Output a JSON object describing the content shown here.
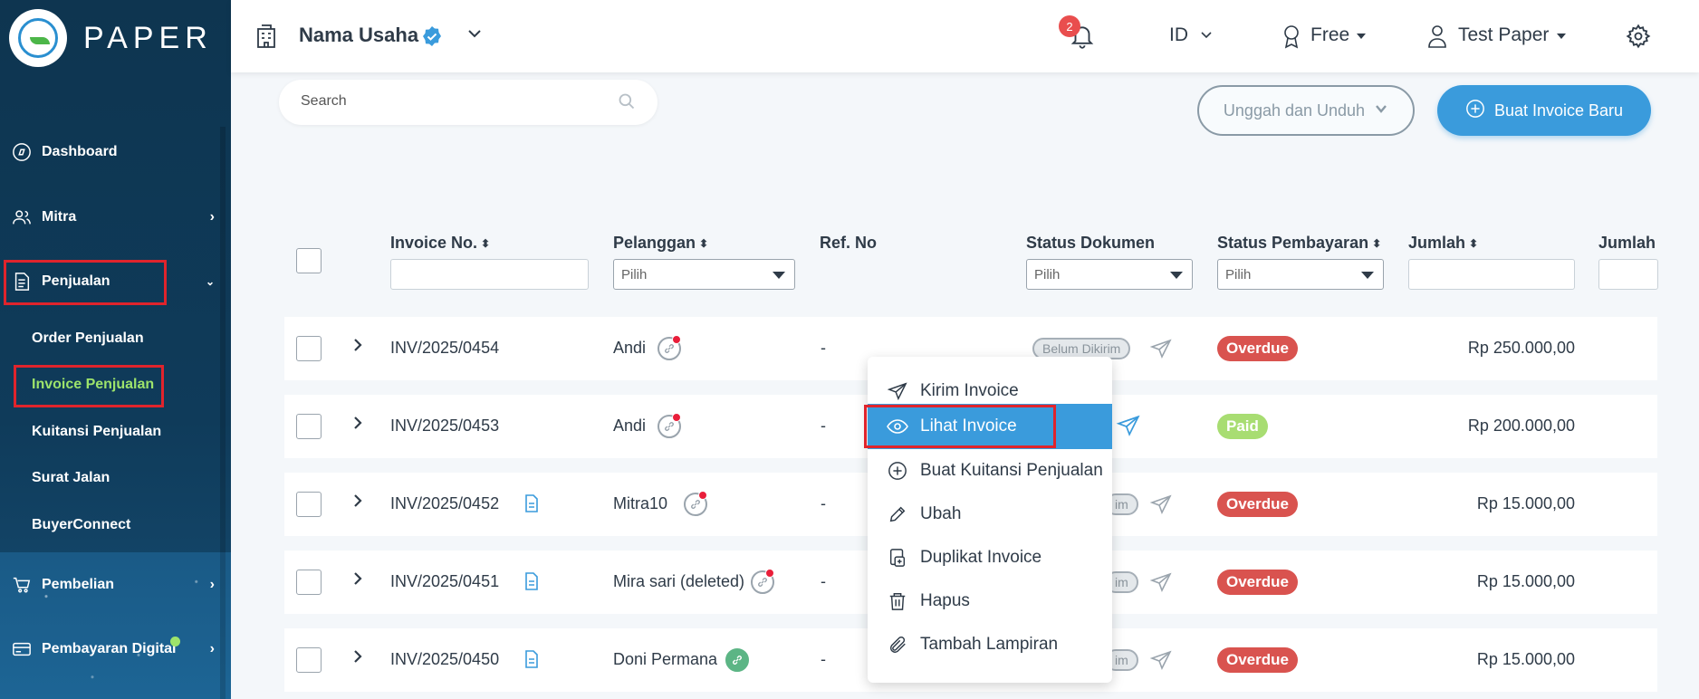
{
  "brand": {
    "name": "PAPER"
  },
  "sidebar": {
    "items": [
      {
        "label": "Dashboard"
      },
      {
        "label": "Mitra"
      },
      {
        "label": "Penjualan"
      },
      {
        "label": "Pembelian"
      },
      {
        "label": "Pembayaran Digital"
      }
    ],
    "sub_items": [
      {
        "label": "Order Penjualan"
      },
      {
        "label": "Invoice Penjualan"
      },
      {
        "label": "Kuitansi Penjualan"
      },
      {
        "label": "Surat Jalan"
      },
      {
        "label": "BuyerConnect"
      }
    ]
  },
  "topbar": {
    "business_name": "Nama Usaha",
    "notification_count": "2",
    "language": "ID",
    "plan": "Free",
    "user": "Test Paper"
  },
  "search": {
    "placeholder": "Search"
  },
  "actions": {
    "upload_download": "Unggah dan Unduh",
    "new_invoice": "Buat Invoice Baru"
  },
  "table": {
    "columns": {
      "invoice_no": "Invoice No.",
      "customer": "Pelanggan",
      "ref_no": "Ref. No",
      "doc_status": "Status Dokumen",
      "pay_status": "Status Pembayaran",
      "amount": "Jumlah",
      "amount2": "Jumlah T"
    },
    "filter_placeholder": "Pilih",
    "rows": [
      {
        "invoice": "INV/2025/0454",
        "customer": "Andi",
        "ref": "-",
        "doc_status": "Belum Dikirim",
        "pay_status": "Overdue",
        "amount": "Rp 250.000,00"
      },
      {
        "invoice": "INV/2025/0453",
        "customer": "Andi",
        "ref": "-",
        "doc_status": "",
        "pay_status": "Paid",
        "amount": "Rp 200.000,00"
      },
      {
        "invoice": "INV/2025/0452",
        "customer": "Mitra10",
        "ref": "-",
        "doc_status": "im",
        "pay_status": "Overdue",
        "amount": "Rp 15.000,00"
      },
      {
        "invoice": "INV/2025/0451",
        "customer": "Mira sari (deleted)",
        "ref": "-",
        "doc_status": "im",
        "pay_status": "Overdue",
        "amount": "Rp 15.000,00"
      },
      {
        "invoice": "INV/2025/0450",
        "customer": "Doni Permana",
        "ref": "-",
        "doc_status": "im",
        "pay_status": "Overdue",
        "amount": "Rp 15.000,00"
      }
    ]
  },
  "context_menu": {
    "items": [
      {
        "label": "Kirim Invoice",
        "icon": "send-icon"
      },
      {
        "label": "Lihat Invoice",
        "icon": "eye-icon"
      },
      {
        "label": "Buat Kuitansi Penjualan",
        "icon": "plus-circle-icon"
      },
      {
        "label": "Ubah",
        "icon": "pencil-icon"
      },
      {
        "label": "Duplikat Invoice",
        "icon": "duplicate-icon"
      },
      {
        "label": "Hapus",
        "icon": "trash-icon"
      },
      {
        "label": "Tambah Lampiran",
        "icon": "paperclip-icon"
      }
    ]
  },
  "colors": {
    "primary": "#3a9bdc",
    "sidebar": "#0f3b5a",
    "overdue": "#d9534f",
    "paid": "#a8dd72",
    "highlight": "#e0242c"
  }
}
